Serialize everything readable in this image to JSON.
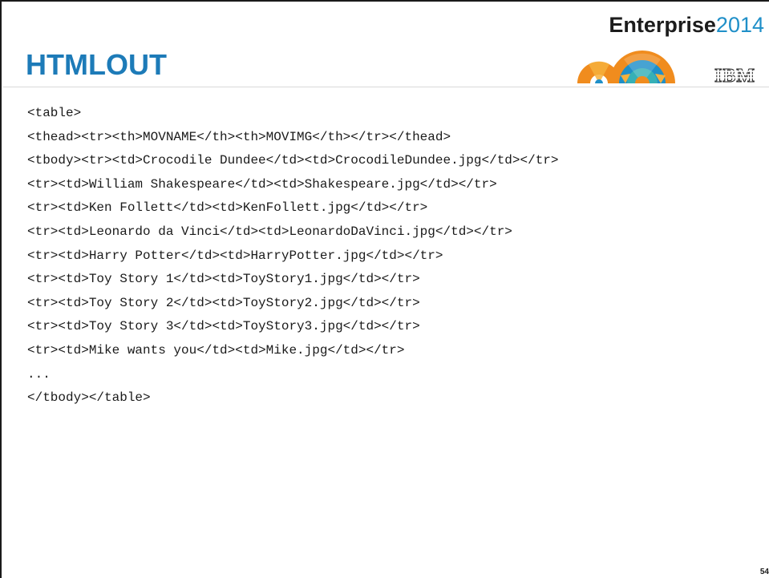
{
  "brand": {
    "bold": "Enterprise",
    "light": "2014"
  },
  "title": "HTMLOUT",
  "ibm_logo_text": "IBM",
  "code_lines": [
    "<table>",
    "<thead><tr><th>MOVNAME</th><th>MOVIMG</th></tr></thead>",
    "<tbody><tr><td>Crocodile Dundee</td><td>CrocodileDundee.jpg</td></tr>",
    "<tr><td>William Shakespeare</td><td>Shakespeare.jpg</td></tr>",
    "<tr><td>Ken Follett</td><td>KenFollett.jpg</td></tr>",
    "<tr><td>Leonardo da Vinci</td><td>LeonardoDaVinci.jpg</td></tr>",
    "<tr><td>Harry Potter</td><td>HarryPotter.jpg</td></tr>",
    "<tr><td>Toy Story 1</td><td>ToyStory1.jpg</td></tr>",
    "<tr><td>Toy Story 2</td><td>ToyStory2.jpg</td></tr>",
    "<tr><td>Toy Story 3</td><td>ToyStory3.jpg</td></tr>",
    "<tr><td>Mike wants you</td><td>Mike.jpg</td></tr>",
    "...",
    "</tbody></table>"
  ],
  "page_number": "54",
  "colors": {
    "title": "#1d7bb8",
    "brand_year": "#1f8fc8",
    "arc_orange": "#f08c1e",
    "arc_blue": "#1f8fc8",
    "arc_teal": "#36b0b6"
  },
  "icons": [
    "enterprise-arcs-graphic",
    "ibm-logo"
  ]
}
